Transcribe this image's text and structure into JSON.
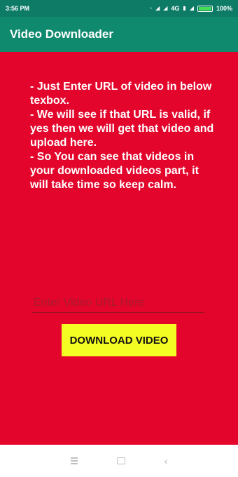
{
  "status_bar": {
    "time": "3:56 PM",
    "network": "4G",
    "battery_percent": "100%",
    "battery_level": 1.0
  },
  "app_bar": {
    "title": "Video Downloader"
  },
  "instructions": [
    "- Just Enter URL of video in below texbox.",
    "- We will see if that URL is valid, if yes then we will get that video and upload here.",
    "- So You can see that videos in your downloaded videos part, it will take time so keep calm."
  ],
  "url_input": {
    "value": "",
    "placeholder": "Enter Video URL Here"
  },
  "download_button": {
    "label": "DOWNLOAD VIDEO"
  },
  "colors": {
    "status_bar": "#0e7b67",
    "app_bar": "#108a6f",
    "content_background": "#e3052c",
    "button_background": "#f4fd23"
  },
  "icons": {
    "status": [
      "notification-icon",
      "signal-icon",
      "wifi-icon",
      "battery-icon"
    ],
    "nav": [
      "menu-icon",
      "home-icon",
      "back-icon"
    ]
  }
}
